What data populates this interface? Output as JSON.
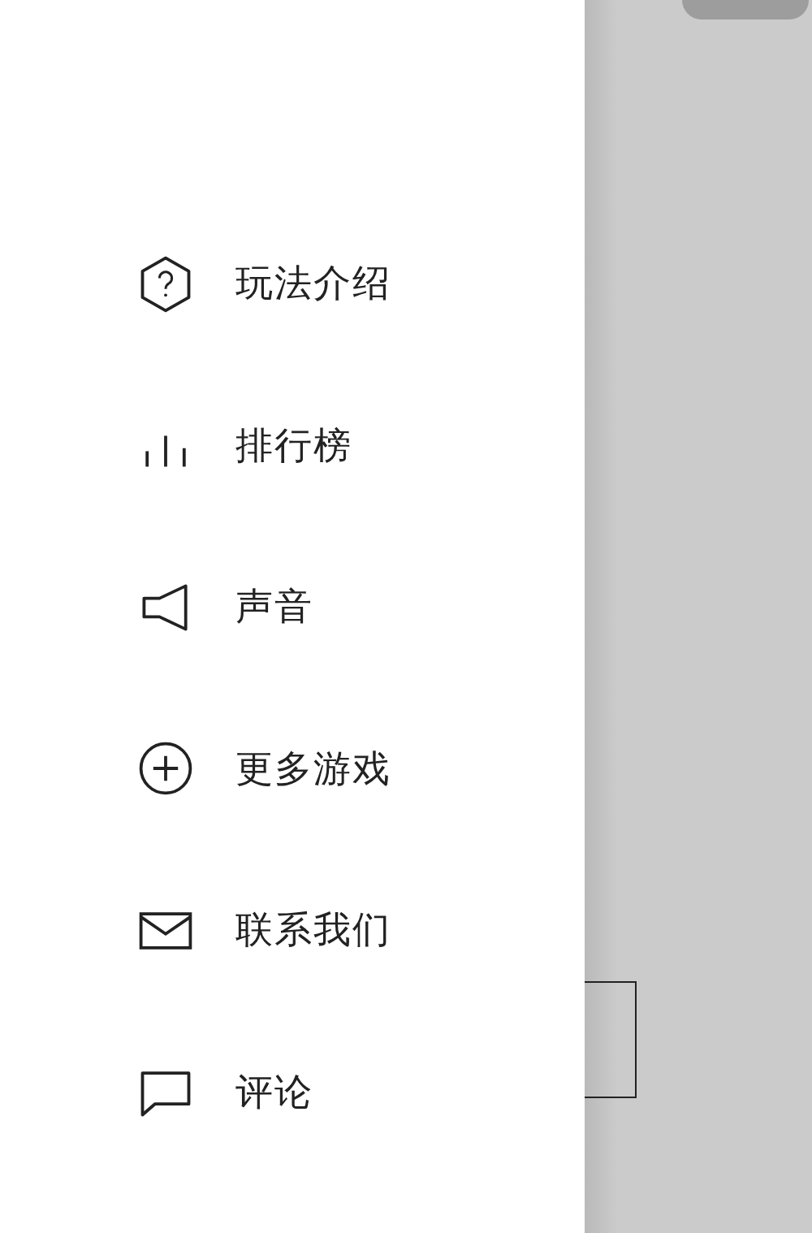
{
  "menu": {
    "items": [
      {
        "kind": "help",
        "label": "玩法介绍"
      },
      {
        "kind": "ranking",
        "label": "排行榜"
      },
      {
        "kind": "sound",
        "label": "声音"
      },
      {
        "kind": "more",
        "label": "更多游戏"
      },
      {
        "kind": "mail",
        "label": "联系我们"
      },
      {
        "kind": "comment",
        "label": "评论"
      }
    ]
  }
}
